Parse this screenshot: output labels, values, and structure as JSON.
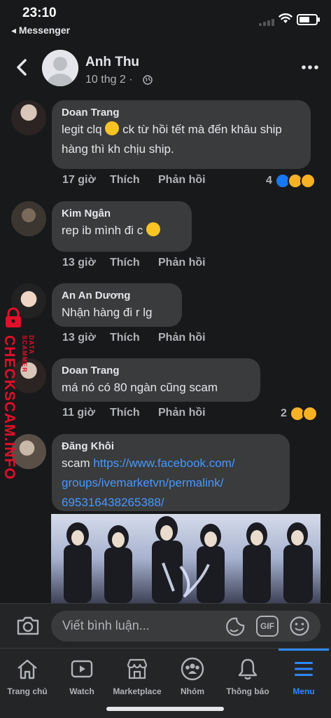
{
  "status_bar": {
    "time": "23:10",
    "back_app": "◂ Messenger"
  },
  "header": {
    "name": "Anh Thu",
    "date": "10 thg 2 ·"
  },
  "comments": [
    {
      "author": "Doan Trang",
      "text_before": "legit clq ",
      "text_after": " ck từ hồi tết mà đến khâu ship hàng thì kh chịu ship.",
      "time": "17 giờ",
      "like": "Thích",
      "reply": "Phản hồi",
      "reaction_count": "4"
    },
    {
      "author": "Kim Ngân",
      "text": "rep ib mình đi c ",
      "time": "13 giờ",
      "like": "Thích",
      "reply": "Phản hồi"
    },
    {
      "author": "An An Dương",
      "text": "Nhận hàng đi r lg",
      "time": "13 giờ",
      "like": "Thích",
      "reply": "Phản hồi"
    },
    {
      "author": "Doan Trang",
      "text": "má nó có 80 ngàn cũng scam",
      "time": "11 giờ",
      "like": "Thích",
      "reply": "Phản hồi",
      "reaction_count": "2"
    },
    {
      "author": "Đăng Khôi",
      "text": "scam ",
      "link_line1": "https://www.facebook.com/",
      "link_line2": "groups/ivemarketvn/permalink/",
      "link_line3": "695316438265388/"
    }
  ],
  "watermark": {
    "brand": "CHECKSCAM.INFO",
    "tag": "DATA SCAMMER"
  },
  "composer": {
    "placeholder": "Viết bình luận...",
    "gif": "GIF"
  },
  "nav": {
    "items": [
      {
        "label": "Trang chủ",
        "icon": "home-icon"
      },
      {
        "label": "Watch",
        "icon": "watch-icon"
      },
      {
        "label": "Marketplace",
        "icon": "marketplace-icon"
      },
      {
        "label": "Nhóm",
        "icon": "groups-icon"
      },
      {
        "label": "Thông báo",
        "icon": "bell-icon"
      },
      {
        "label": "Menu",
        "icon": "menu-icon"
      }
    ]
  },
  "colors": {
    "link": "#4599ff",
    "accent": "#2d88ff",
    "bubble": "#3a3b3c",
    "background": "#18191a",
    "watermark": "#e0102a"
  }
}
